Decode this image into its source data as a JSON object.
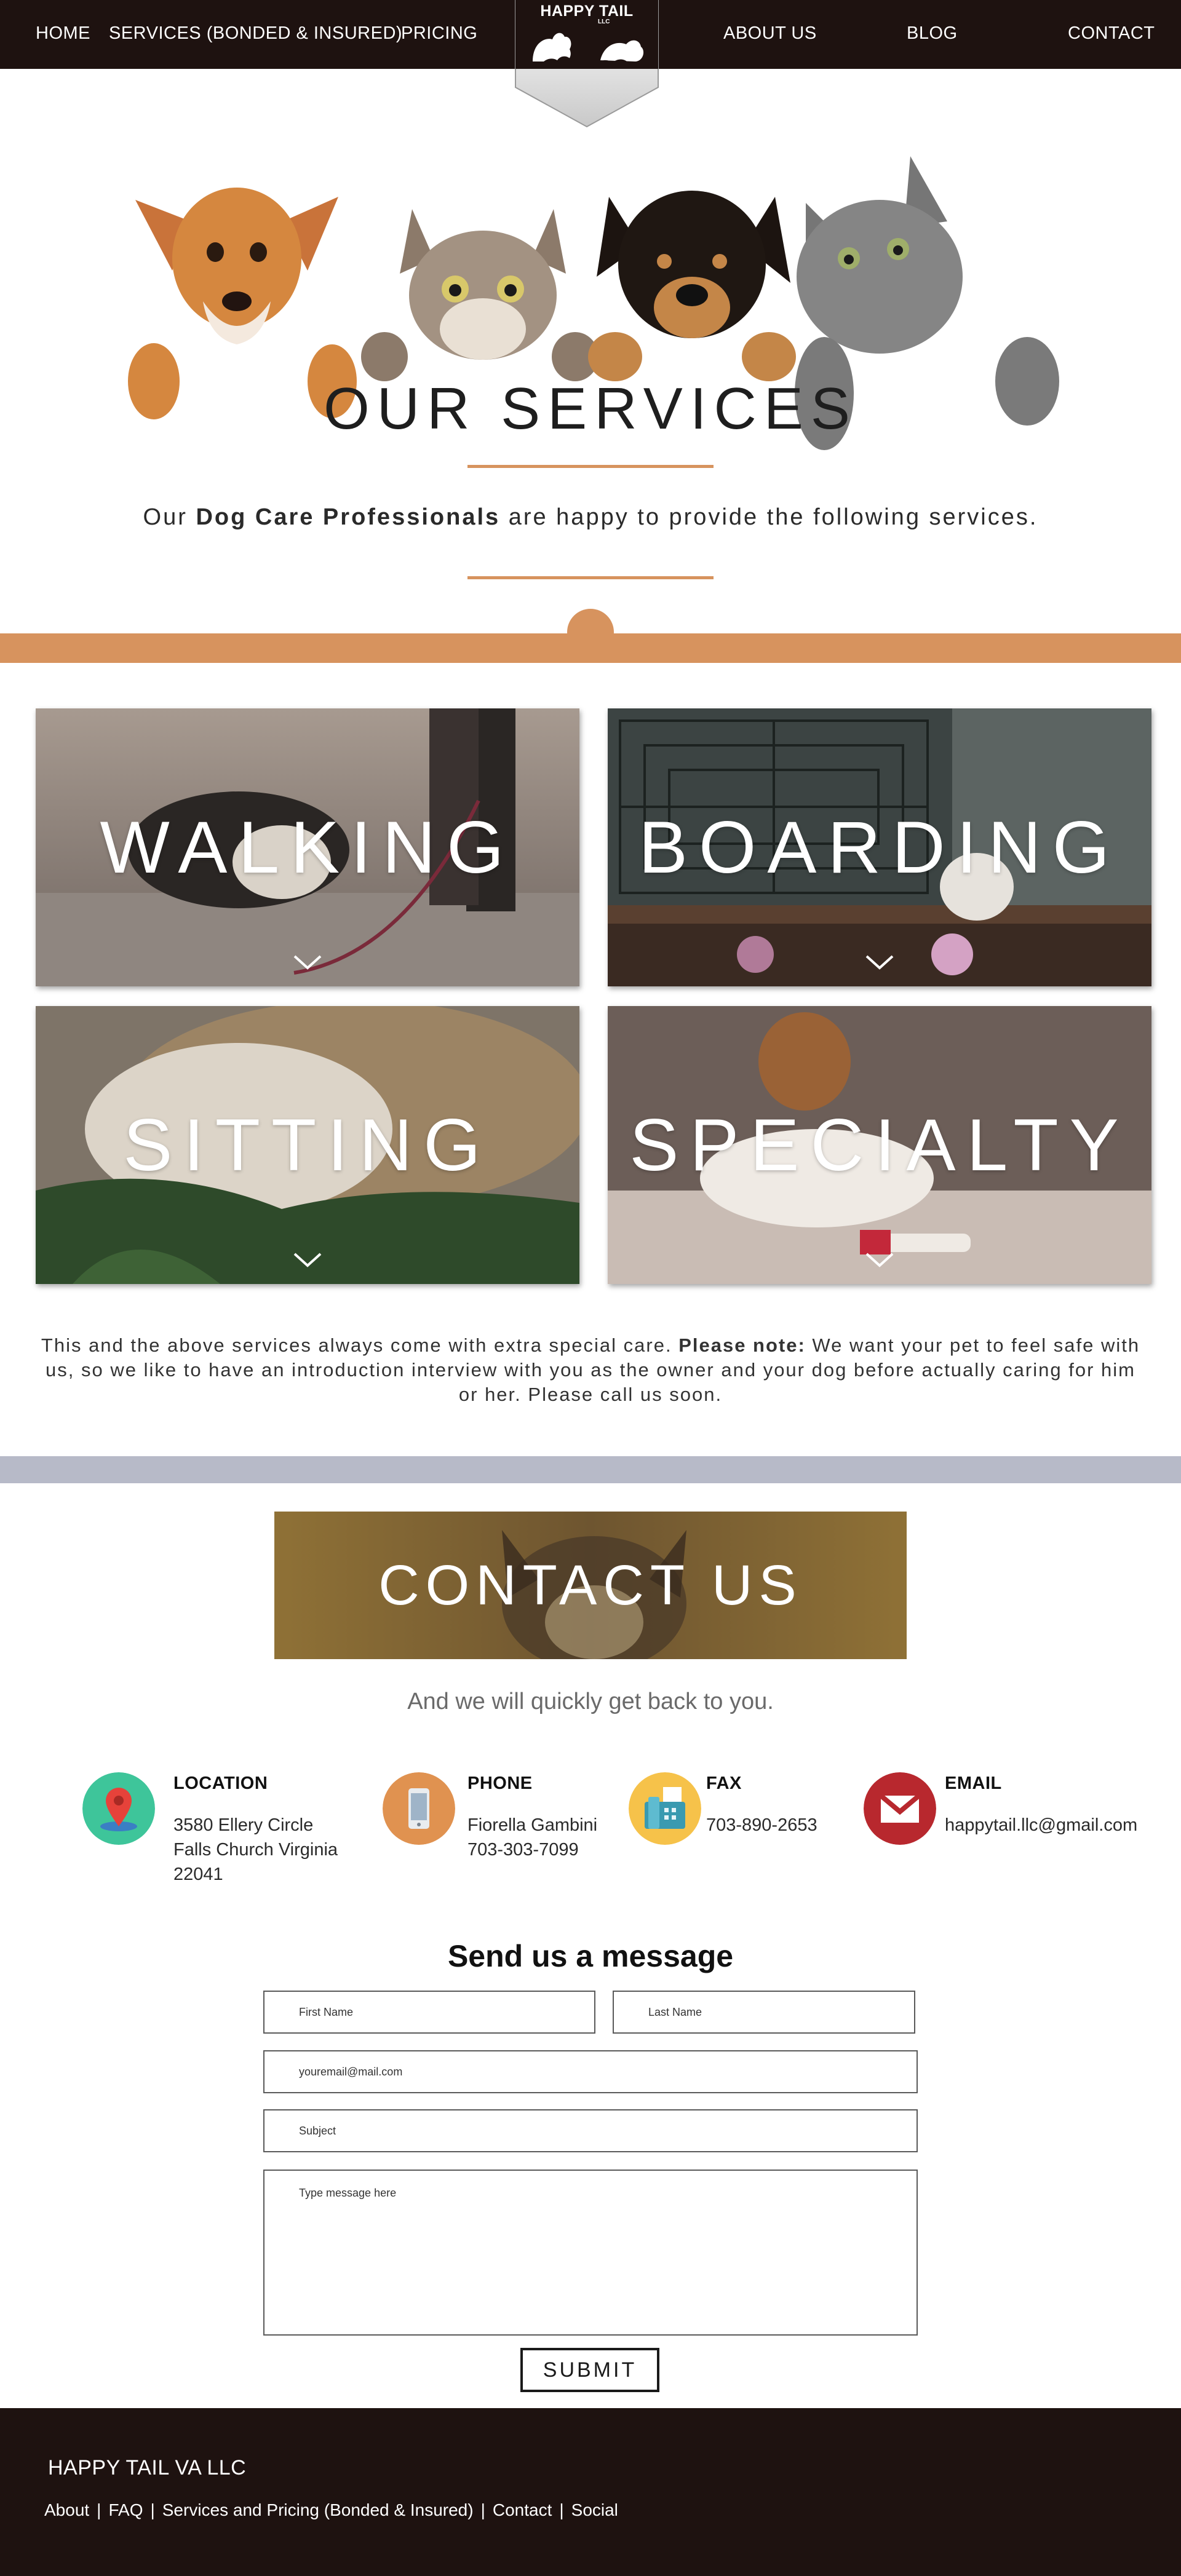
{
  "nav": {
    "links": [
      "HOME",
      "SERVICES (BONDED & INSURED)",
      "PRICING",
      "ABOUT US",
      "BLOG",
      "CONTACT"
    ],
    "logo_text": "HAPPY TAIL",
    "logo_sub": "LLC"
  },
  "hero": {
    "title": "OUR SERVICES",
    "intro_prefix": "Our ",
    "intro_bold": "Dog Care Professionals",
    "intro_suffix": " are happy to provide the following services."
  },
  "services": [
    "WALKING",
    "BOARDING",
    "SITTING",
    "SPECIALTY"
  ],
  "note": {
    "prefix": "This and the above services always come with extra special care. ",
    "bold": "Please note:",
    "suffix": " We want your pet to feel safe with us, so we like to have an introduction interview with you as the owner and your dog before actually caring for him or her. Please call us soon."
  },
  "contact": {
    "title": "CONTACT US",
    "subtitle": "And we will quickly get back to you.",
    "location": {
      "title": "LOCATION",
      "lines": [
        "3580 Ellery Circle",
        "Falls Church Virginia",
        "22041"
      ]
    },
    "phone": {
      "title": "PHONE",
      "lines": [
        "Fiorella Gambini",
        "703-303-7099"
      ]
    },
    "fax": {
      "title": "FAX",
      "lines": [
        "703-890-2653"
      ]
    },
    "email": {
      "title": "EMAIL",
      "lines": [
        "happytail.llc@gmail.com"
      ]
    }
  },
  "form": {
    "title": "Send us a message",
    "first_name": "First Name",
    "last_name": "Last Name",
    "email": "youremail@mail.com",
    "subject": "Subject",
    "message": "Type message here",
    "submit": "SUBMIT"
  },
  "footer": {
    "title": "HAPPY TAIL VA LLC",
    "links": [
      "About",
      "FAQ",
      "Services and Pricing (Bonded & Insured)",
      "Contact",
      "Social"
    ],
    "separator": "|"
  },
  "colors": {
    "nav_bg": "#1e1210",
    "accent": "#d7935e",
    "grey_band": "#b7bac8",
    "footer_bg": "#1e1210"
  }
}
